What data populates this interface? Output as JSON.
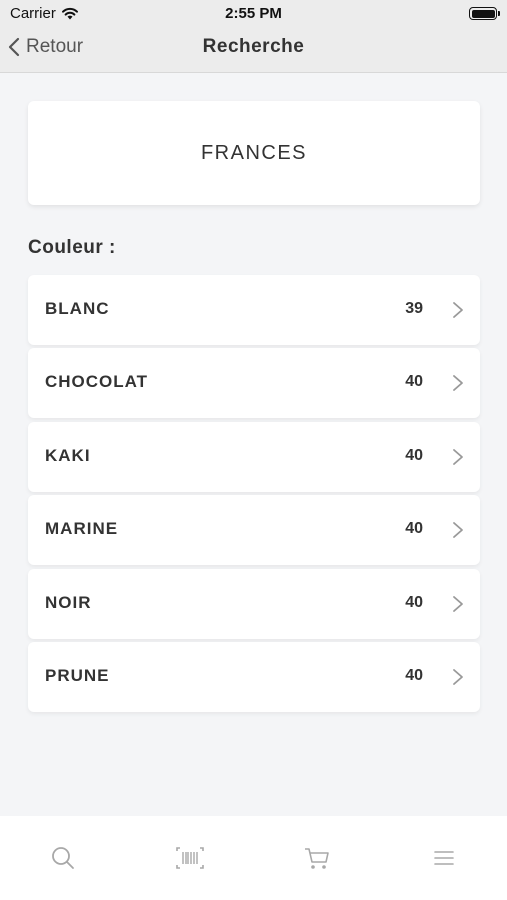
{
  "status_bar": {
    "carrier": "Carrier",
    "time": "2:55 PM",
    "battery_level": 1.0
  },
  "nav": {
    "back_label": "Retour",
    "title": "Recherche"
  },
  "search_term": "FRANCES",
  "section_label": "Couleur :",
  "colors": [
    {
      "label": "BLANC",
      "count": "39"
    },
    {
      "label": "CHOCOLAT",
      "count": "40"
    },
    {
      "label": "KAKI",
      "count": "40"
    },
    {
      "label": "MARINE",
      "count": "40"
    },
    {
      "label": "NOIR",
      "count": "40"
    },
    {
      "label": "PRUNE",
      "count": "40"
    }
  ],
  "tabs": [
    {
      "icon": "search-icon"
    },
    {
      "icon": "barcode-icon"
    },
    {
      "icon": "cart-icon"
    },
    {
      "icon": "menu-icon"
    }
  ],
  "colors_palette": {
    "background": "#f4f5f7",
    "bar": "#ececec",
    "text": "#333333",
    "icon_gray": "#a8a8a8"
  }
}
